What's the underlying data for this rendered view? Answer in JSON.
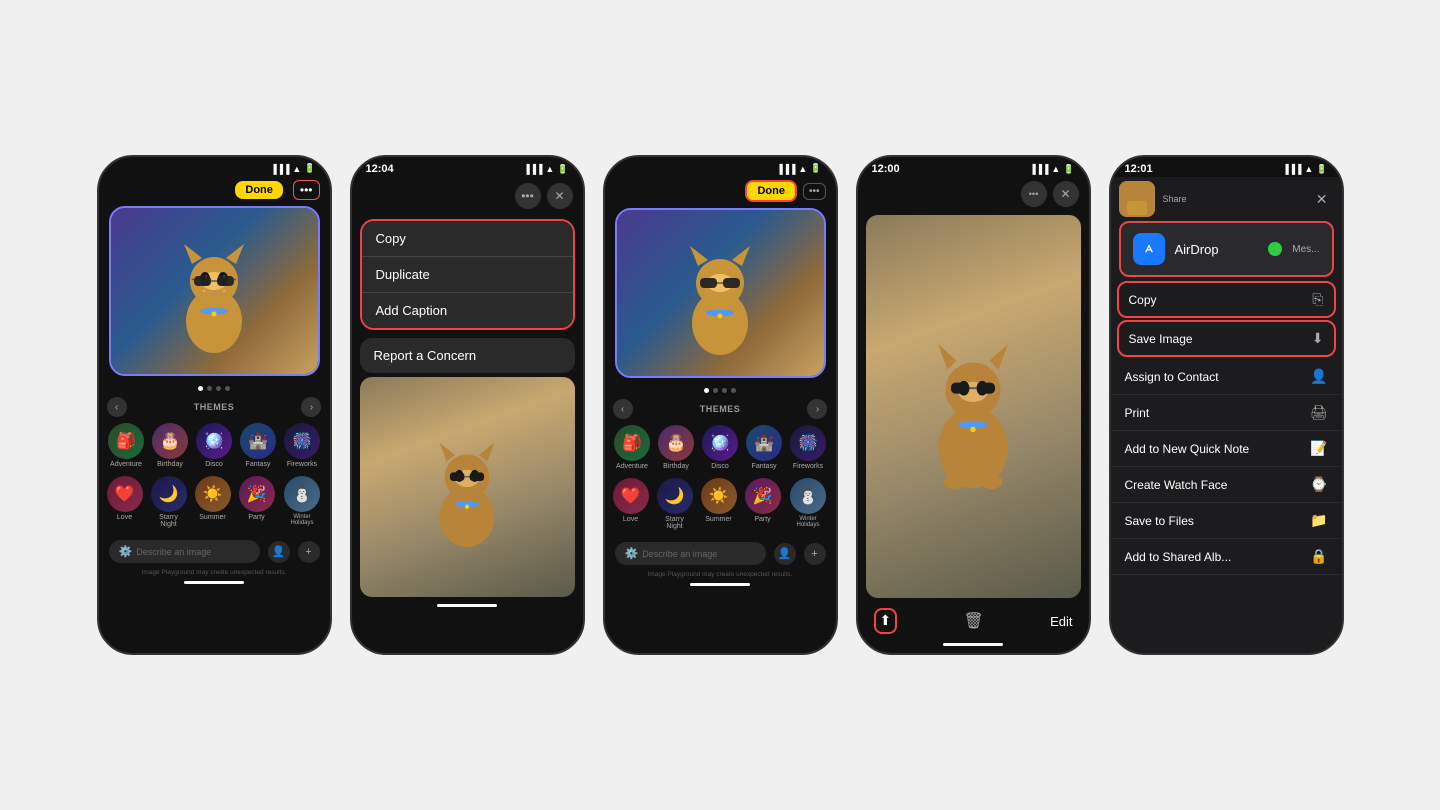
{
  "page": {
    "background": "#f0f0f0"
  },
  "screen1": {
    "done_label": "Done",
    "dots_label": "•••",
    "themes_label": "THEMES",
    "describe_placeholder": "Describe an image",
    "disclaimer": "Image Playground may create unexpected results.",
    "themes": [
      {
        "name": "Adventure",
        "emoji": "🎒"
      },
      {
        "name": "Birthday",
        "emoji": "🎂"
      },
      {
        "name": "Disco",
        "emoji": "🪩"
      },
      {
        "name": "Fantasy",
        "emoji": "🏰"
      },
      {
        "name": "Fireworks",
        "emoji": "🎆"
      },
      {
        "name": "Love",
        "emoji": "❤️"
      },
      {
        "name": "Starry Night",
        "emoji": "🌙"
      },
      {
        "name": "Summer",
        "emoji": "☀️"
      },
      {
        "name": "Party",
        "emoji": "🎉"
      },
      {
        "name": "Winter Holidays",
        "emoji": "⛄"
      }
    ]
  },
  "screen2": {
    "time": "12:04",
    "menu_items": [
      {
        "label": "Copy",
        "highlighted": true
      },
      {
        "label": "Duplicate",
        "highlighted": true
      },
      {
        "label": "Add Caption",
        "highlighted": true
      },
      {
        "label": "Report a Concern",
        "highlighted": false
      }
    ]
  },
  "screen3": {
    "done_label": "Done",
    "dots_label": "•••",
    "themes_label": "THEMES",
    "describe_placeholder": "Describe an image",
    "disclaimer": "Image Playground may create unexpected results."
  },
  "screen4": {
    "time": "12:00",
    "dots_label": "•••",
    "edit_label": "Edit",
    "share_icon": "⬆",
    "trash_icon": "🗑"
  },
  "screen5": {
    "time": "12:01",
    "airdrop_label": "AirDrop",
    "mes_label": "Mes...",
    "copy_label": "Copy",
    "save_image_label": "Save Image",
    "assign_contact_label": "Assign to Contact",
    "print_label": "Print",
    "quick_note_label": "Add to New Quick Note",
    "watch_face_label": "Create Watch Face",
    "save_files_label": "Save to Files",
    "shared_label": "Add to Shared Alb..."
  },
  "icons": {
    "copy": "⎘",
    "save": "⬇",
    "contact": "👤",
    "print": "🖨",
    "note": "📝",
    "watch": "⌚",
    "folder": "📁",
    "shared": "🔒"
  }
}
